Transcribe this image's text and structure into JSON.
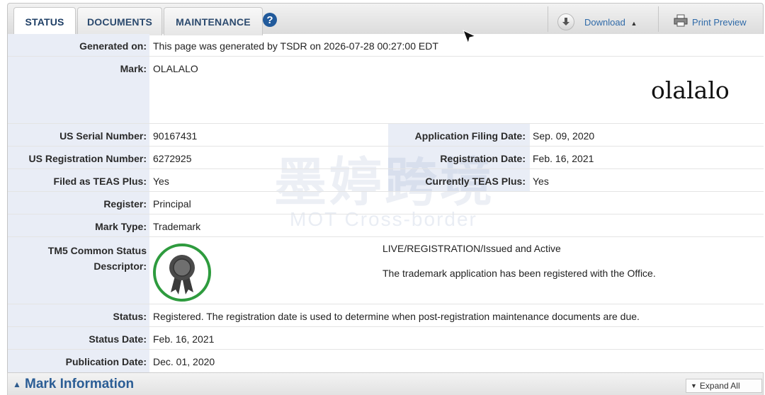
{
  "tabs": [
    {
      "label": "STATUS",
      "active": true
    },
    {
      "label": "DOCUMENTS",
      "active": false
    },
    {
      "label": "MAINTENANCE",
      "active": false
    }
  ],
  "toolbar": {
    "help_icon": "question-circle-icon",
    "download_label": "Download",
    "print_label": "Print Preview"
  },
  "fields": {
    "generated_on": {
      "label": "Generated on:",
      "value": "This page was generated by TSDR on 2026-07-28 00:27:00 EDT"
    },
    "mark": {
      "label": "Mark:",
      "value": "OLALALO",
      "image_text": "olalalo"
    },
    "serial": {
      "label": "US Serial Number:",
      "value": "90167431"
    },
    "filing_date": {
      "label": "Application Filing Date:",
      "value": "Sep. 09, 2020"
    },
    "reg_number": {
      "label": "US Registration Number:",
      "value": "6272925"
    },
    "reg_date": {
      "label": "Registration Date:",
      "value": "Feb. 16, 2021"
    },
    "teas_plus": {
      "label": "Filed as TEAS Plus:",
      "value": "Yes"
    },
    "current_teas": {
      "label": "Currently TEAS Plus:",
      "value": "Yes"
    },
    "register": {
      "label": "Register:",
      "value": "Principal"
    },
    "mark_type": {
      "label": "Mark Type:",
      "value": "Trademark"
    },
    "tm5": {
      "label_line1": "TM5 Common Status",
      "label_line2": "Descriptor:",
      "title": "LIVE/REGISTRATION/Issued and Active",
      "description": "The trademark application has been registered with the Office."
    },
    "status": {
      "label": "Status:",
      "value": "Registered. The registration date is used to determine when post-registration maintenance documents are due."
    },
    "status_date": {
      "label": "Status Date:",
      "value": "Feb. 16, 2021"
    },
    "publication_date": {
      "label": "Publication Date:",
      "value": "Dec. 01, 2020"
    }
  },
  "watermark": {
    "cn": "墨婷跨境",
    "en": "MOT Cross-border"
  },
  "section": {
    "title": "Mark Information",
    "expand_label": "Expand All"
  },
  "colors": {
    "accent": "#2b5d95",
    "badge_ring": "#2e9b3e",
    "label_bg": "#e9edf6"
  }
}
